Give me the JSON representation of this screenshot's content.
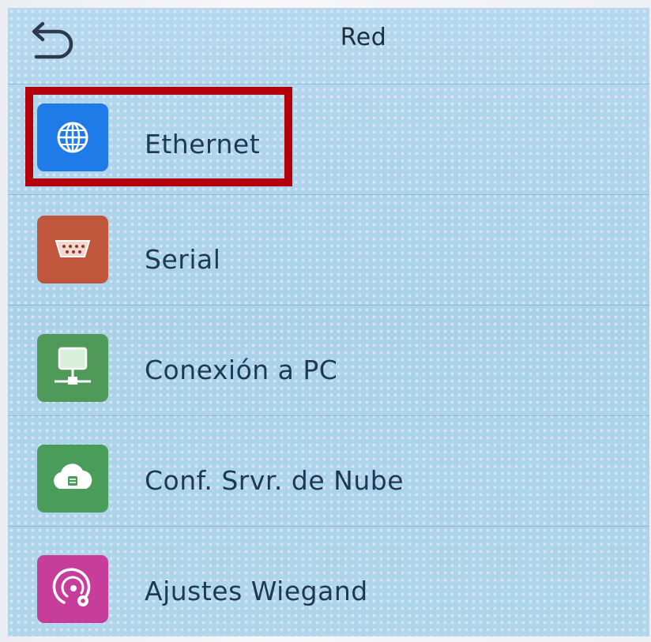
{
  "header": {
    "title": "Red",
    "back_icon": "back-arrow-icon"
  },
  "menu": {
    "items": [
      {
        "label": "Ethernet",
        "icon": "globe-icon",
        "color": "#1f7be8"
      },
      {
        "label": "Serial",
        "icon": "serial-port-icon",
        "color": "#c0563b"
      },
      {
        "label": "Conexión a PC",
        "icon": "pc-connection-icon",
        "color": "#4f9a59"
      },
      {
        "label": "Conf. Srvr. de Nube",
        "icon": "cloud-server-icon",
        "color": "#4a9c5a"
      },
      {
        "label": "Ajustes Wiegand",
        "icon": "wiegand-settings-icon",
        "color": "#c63e99"
      }
    ]
  },
  "highlight": {
    "target": "Ethernet",
    "color": "#b4000a"
  }
}
